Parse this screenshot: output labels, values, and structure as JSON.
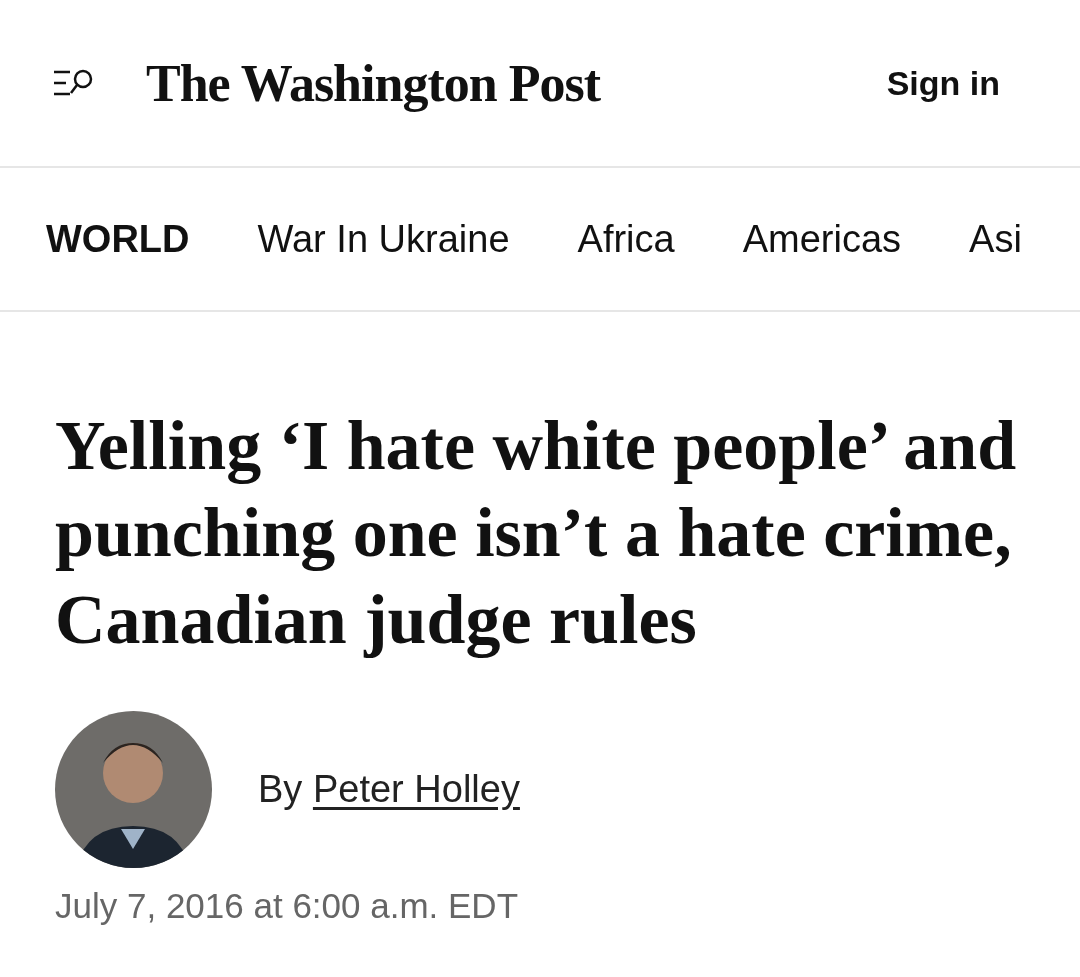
{
  "header": {
    "logo": "The Washington Post",
    "sign_in": "Sign in"
  },
  "nav": [
    {
      "label": "WORLD",
      "selected": true
    },
    {
      "label": "War In Ukraine",
      "selected": false
    },
    {
      "label": "Africa",
      "selected": false
    },
    {
      "label": "Americas",
      "selected": false
    },
    {
      "label": "Asi",
      "selected": false
    }
  ],
  "article": {
    "headline": "Yelling ‘I hate white people’ and punching one isn’t a hate crime, Canadian judge rules",
    "byline_prefix": "By",
    "author": "Peter Holley",
    "date": "July 7, 2016 at 6:00 a.m. EDT"
  }
}
